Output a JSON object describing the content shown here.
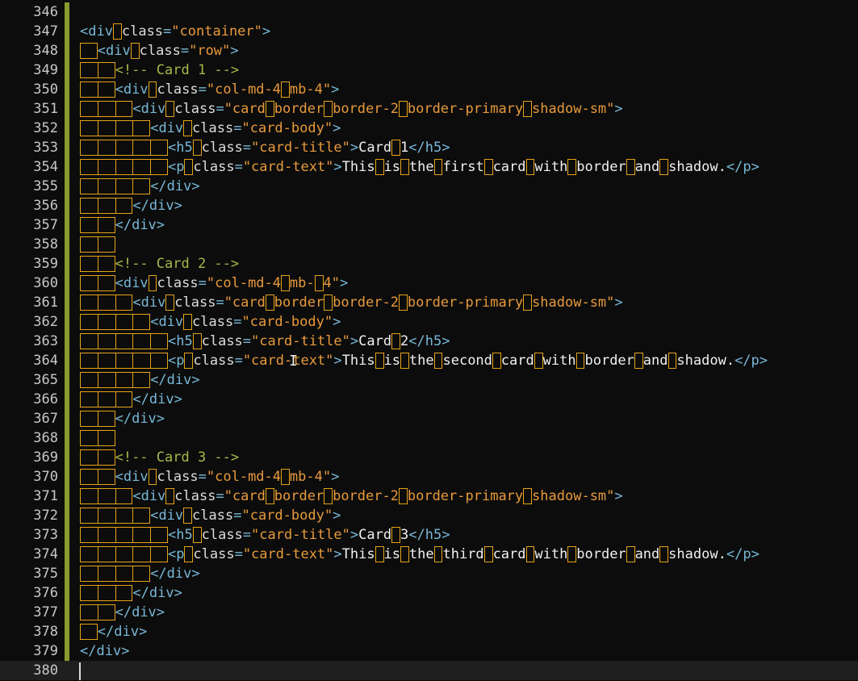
{
  "editor": {
    "colors": {
      "background": "#0c0c0c",
      "current_line": "#1f1f1f",
      "line_number": "#c8c8c8",
      "tag": "#78b8d8",
      "attr": "#dcdcdc",
      "string": "#e89a3c",
      "comment": "#a6b84a",
      "text": "#f0f0f0",
      "whitespace_marker": "#e6a317",
      "modified_bar": "#8a9a2f"
    },
    "current_line": 380,
    "lines": [
      {
        "n": "346",
        "ind": 0,
        "tokens": []
      },
      {
        "n": "347",
        "ind": 0,
        "tokens": [
          [
            "p",
            "<"
          ],
          [
            "t",
            "div"
          ],
          [
            "s",
            " "
          ],
          [
            "a",
            "class"
          ],
          [
            "p",
            "="
          ],
          [
            "v",
            "\"container\""
          ],
          [
            "p",
            ">"
          ]
        ]
      },
      {
        "n": "348",
        "ind": 1,
        "tokens": [
          [
            "p",
            "<"
          ],
          [
            "t",
            "div"
          ],
          [
            "s",
            " "
          ],
          [
            "a",
            "class"
          ],
          [
            "p",
            "="
          ],
          [
            "v",
            "\"row\""
          ],
          [
            "p",
            ">"
          ]
        ]
      },
      {
        "n": "349",
        "ind": 2,
        "tokens": [
          [
            "c",
            "<!-- Card 1 -->"
          ]
        ]
      },
      {
        "n": "350",
        "ind": 2,
        "tokens": [
          [
            "p",
            "<"
          ],
          [
            "t",
            "div"
          ],
          [
            "s",
            " "
          ],
          [
            "a",
            "class"
          ],
          [
            "p",
            "="
          ],
          [
            "v",
            "\"col-md-4"
          ],
          [
            "s",
            " "
          ],
          [
            "v",
            "mb-4\""
          ],
          [
            "p",
            ">"
          ]
        ]
      },
      {
        "n": "351",
        "ind": 3,
        "tokens": [
          [
            "p",
            "<"
          ],
          [
            "t",
            "div"
          ],
          [
            "s",
            " "
          ],
          [
            "a",
            "class"
          ],
          [
            "p",
            "="
          ],
          [
            "v",
            "\"card"
          ],
          [
            "s",
            " "
          ],
          [
            "v",
            "border"
          ],
          [
            "s",
            " "
          ],
          [
            "v",
            "border-2"
          ],
          [
            "s",
            " "
          ],
          [
            "v",
            "border-primary"
          ],
          [
            "s",
            " "
          ],
          [
            "v",
            "shadow-sm\""
          ],
          [
            "p",
            ">"
          ]
        ]
      },
      {
        "n": "352",
        "ind": 4,
        "tokens": [
          [
            "p",
            "<"
          ],
          [
            "t",
            "div"
          ],
          [
            "s",
            " "
          ],
          [
            "a",
            "class"
          ],
          [
            "p",
            "="
          ],
          [
            "v",
            "\"card-body\""
          ],
          [
            "p",
            ">"
          ]
        ]
      },
      {
        "n": "353",
        "ind": 5,
        "tokens": [
          [
            "p",
            "<"
          ],
          [
            "t",
            "h5"
          ],
          [
            "s",
            " "
          ],
          [
            "a",
            "class"
          ],
          [
            "p",
            "="
          ],
          [
            "v",
            "\"card-title\""
          ],
          [
            "p",
            ">"
          ],
          [
            "x",
            "Card"
          ],
          [
            "s",
            " "
          ],
          [
            "x",
            "1"
          ],
          [
            "p",
            "</"
          ],
          [
            "t",
            "h5"
          ],
          [
            "p",
            ">"
          ]
        ]
      },
      {
        "n": "354",
        "ind": 5,
        "tokens": [
          [
            "p",
            "<"
          ],
          [
            "t",
            "p"
          ],
          [
            "s",
            " "
          ],
          [
            "a",
            "class"
          ],
          [
            "p",
            "="
          ],
          [
            "v",
            "\"card-text\""
          ],
          [
            "p",
            ">"
          ],
          [
            "x",
            "This"
          ],
          [
            "s",
            " "
          ],
          [
            "x",
            "is"
          ],
          [
            "s",
            " "
          ],
          [
            "x",
            "the"
          ],
          [
            "s",
            " "
          ],
          [
            "x",
            "first"
          ],
          [
            "s",
            " "
          ],
          [
            "x",
            "card"
          ],
          [
            "s",
            " "
          ],
          [
            "x",
            "with"
          ],
          [
            "s",
            " "
          ],
          [
            "x",
            "border"
          ],
          [
            "s",
            " "
          ],
          [
            "x",
            "and"
          ],
          [
            "s",
            " "
          ],
          [
            "x",
            "shadow."
          ],
          [
            "p",
            "</"
          ],
          [
            "t",
            "p"
          ],
          [
            "p",
            ">"
          ]
        ]
      },
      {
        "n": "355",
        "ind": 4,
        "tokens": [
          [
            "p",
            "</"
          ],
          [
            "t",
            "div"
          ],
          [
            "p",
            ">"
          ]
        ]
      },
      {
        "n": "356",
        "ind": 3,
        "tokens": [
          [
            "p",
            "</"
          ],
          [
            "t",
            "div"
          ],
          [
            "p",
            ">"
          ]
        ]
      },
      {
        "n": "357",
        "ind": 2,
        "tokens": [
          [
            "p",
            "</"
          ],
          [
            "t",
            "div"
          ],
          [
            "p",
            ">"
          ]
        ]
      },
      {
        "n": "358",
        "ind": 2,
        "tokens": []
      },
      {
        "n": "359",
        "ind": 2,
        "tokens": [
          [
            "c",
            "<!-- Card 2 -->"
          ]
        ]
      },
      {
        "n": "360",
        "ind": 2,
        "tokens": [
          [
            "p",
            "<"
          ],
          [
            "t",
            "div"
          ],
          [
            "s",
            " "
          ],
          [
            "a",
            "class"
          ],
          [
            "p",
            "="
          ],
          [
            "v",
            "\"col-md-4"
          ],
          [
            "s",
            " "
          ],
          [
            "v",
            "mb-"
          ],
          [
            "s",
            " "
          ],
          [
            "v",
            "4\""
          ],
          [
            "p",
            ">"
          ]
        ]
      },
      {
        "n": "361",
        "ind": 3,
        "tokens": [
          [
            "p",
            "<"
          ],
          [
            "t",
            "div"
          ],
          [
            "s",
            " "
          ],
          [
            "a",
            "class"
          ],
          [
            "p",
            "="
          ],
          [
            "v",
            "\"card"
          ],
          [
            "s",
            " "
          ],
          [
            "v",
            "border"
          ],
          [
            "s",
            " "
          ],
          [
            "v",
            "border-2"
          ],
          [
            "s",
            " "
          ],
          [
            "v",
            "border-primary"
          ],
          [
            "s",
            " "
          ],
          [
            "v",
            "shadow-sm\""
          ],
          [
            "p",
            ">"
          ]
        ]
      },
      {
        "n": "362",
        "ind": 4,
        "tokens": [
          [
            "p",
            "<"
          ],
          [
            "t",
            "div"
          ],
          [
            "s",
            " "
          ],
          [
            "a",
            "class"
          ],
          [
            "p",
            "="
          ],
          [
            "v",
            "\"card-body\""
          ],
          [
            "p",
            ">"
          ]
        ]
      },
      {
        "n": "363",
        "ind": 5,
        "tokens": [
          [
            "p",
            "<"
          ],
          [
            "t",
            "h5"
          ],
          [
            "s",
            " "
          ],
          [
            "a",
            "class"
          ],
          [
            "p",
            "="
          ],
          [
            "v",
            "\"card-title\""
          ],
          [
            "p",
            ">"
          ],
          [
            "x",
            "Card"
          ],
          [
            "s",
            " "
          ],
          [
            "x",
            "2"
          ],
          [
            "p",
            "</"
          ],
          [
            "t",
            "h5"
          ],
          [
            "p",
            ">"
          ]
        ]
      },
      {
        "n": "364",
        "ind": 5,
        "tokens": [
          [
            "p",
            "<"
          ],
          [
            "t",
            "p"
          ],
          [
            "s",
            " "
          ],
          [
            "a",
            "class"
          ],
          [
            "p",
            "="
          ],
          [
            "v",
            "\"card-text\""
          ],
          [
            "p",
            ">"
          ],
          [
            "x",
            "This"
          ],
          [
            "s",
            " "
          ],
          [
            "x",
            "is"
          ],
          [
            "s",
            " "
          ],
          [
            "x",
            "the"
          ],
          [
            "s",
            " "
          ],
          [
            "x",
            "second"
          ],
          [
            "s",
            " "
          ],
          [
            "x",
            "card"
          ],
          [
            "s",
            " "
          ],
          [
            "x",
            "with"
          ],
          [
            "s",
            " "
          ],
          [
            "x",
            "border"
          ],
          [
            "s",
            " "
          ],
          [
            "x",
            "and"
          ],
          [
            "s",
            " "
          ],
          [
            "x",
            "shadow."
          ],
          [
            "p",
            "</"
          ],
          [
            "t",
            "p"
          ],
          [
            "p",
            ">"
          ]
        ]
      },
      {
        "n": "365",
        "ind": 4,
        "tokens": [
          [
            "p",
            "</"
          ],
          [
            "t",
            "div"
          ],
          [
            "p",
            ">"
          ]
        ]
      },
      {
        "n": "366",
        "ind": 3,
        "tokens": [
          [
            "p",
            "</"
          ],
          [
            "t",
            "div"
          ],
          [
            "p",
            ">"
          ]
        ]
      },
      {
        "n": "367",
        "ind": 2,
        "tokens": [
          [
            "p",
            "</"
          ],
          [
            "t",
            "div"
          ],
          [
            "p",
            ">"
          ]
        ]
      },
      {
        "n": "368",
        "ind": 2,
        "tokens": []
      },
      {
        "n": "369",
        "ind": 2,
        "tokens": [
          [
            "c",
            "<!-- Card 3 -->"
          ]
        ]
      },
      {
        "n": "370",
        "ind": 2,
        "tokens": [
          [
            "p",
            "<"
          ],
          [
            "t",
            "div"
          ],
          [
            "s",
            " "
          ],
          [
            "a",
            "class"
          ],
          [
            "p",
            "="
          ],
          [
            "v",
            "\"col-md-4"
          ],
          [
            "s",
            " "
          ],
          [
            "v",
            "mb-4\""
          ],
          [
            "p",
            ">"
          ]
        ]
      },
      {
        "n": "371",
        "ind": 3,
        "tokens": [
          [
            "p",
            "<"
          ],
          [
            "t",
            "div"
          ],
          [
            "s",
            " "
          ],
          [
            "a",
            "class"
          ],
          [
            "p",
            "="
          ],
          [
            "v",
            "\"card"
          ],
          [
            "s",
            " "
          ],
          [
            "v",
            "border"
          ],
          [
            "s",
            " "
          ],
          [
            "v",
            "border-2"
          ],
          [
            "s",
            " "
          ],
          [
            "v",
            "border-primary"
          ],
          [
            "s",
            " "
          ],
          [
            "v",
            "shadow-sm\""
          ],
          [
            "p",
            ">"
          ]
        ]
      },
      {
        "n": "372",
        "ind": 4,
        "tokens": [
          [
            "p",
            "<"
          ],
          [
            "t",
            "div"
          ],
          [
            "s",
            " "
          ],
          [
            "a",
            "class"
          ],
          [
            "p",
            "="
          ],
          [
            "v",
            "\"card-body\""
          ],
          [
            "p",
            ">"
          ]
        ]
      },
      {
        "n": "373",
        "ind": 5,
        "tokens": [
          [
            "p",
            "<"
          ],
          [
            "t",
            "h5"
          ],
          [
            "s",
            " "
          ],
          [
            "a",
            "class"
          ],
          [
            "p",
            "="
          ],
          [
            "v",
            "\"card-title\""
          ],
          [
            "p",
            ">"
          ],
          [
            "x",
            "Card"
          ],
          [
            "s",
            " "
          ],
          [
            "x",
            "3"
          ],
          [
            "p",
            "</"
          ],
          [
            "t",
            "h5"
          ],
          [
            "p",
            ">"
          ]
        ]
      },
      {
        "n": "374",
        "ind": 5,
        "tokens": [
          [
            "p",
            "<"
          ],
          [
            "t",
            "p"
          ],
          [
            "s",
            " "
          ],
          [
            "a",
            "class"
          ],
          [
            "p",
            "="
          ],
          [
            "v",
            "\"card-text\""
          ],
          [
            "p",
            ">"
          ],
          [
            "x",
            "This"
          ],
          [
            "s",
            " "
          ],
          [
            "x",
            "is"
          ],
          [
            "s",
            " "
          ],
          [
            "x",
            "the"
          ],
          [
            "s",
            " "
          ],
          [
            "x",
            "third"
          ],
          [
            "s",
            " "
          ],
          [
            "x",
            "card"
          ],
          [
            "s",
            " "
          ],
          [
            "x",
            "with"
          ],
          [
            "s",
            " "
          ],
          [
            "x",
            "border"
          ],
          [
            "s",
            " "
          ],
          [
            "x",
            "and"
          ],
          [
            "s",
            " "
          ],
          [
            "x",
            "shadow."
          ],
          [
            "p",
            "</"
          ],
          [
            "t",
            "p"
          ],
          [
            "p",
            ">"
          ]
        ]
      },
      {
        "n": "375",
        "ind": 4,
        "tokens": [
          [
            "p",
            "</"
          ],
          [
            "t",
            "div"
          ],
          [
            "p",
            ">"
          ]
        ]
      },
      {
        "n": "376",
        "ind": 3,
        "tokens": [
          [
            "p",
            "</"
          ],
          [
            "t",
            "div"
          ],
          [
            "p",
            ">"
          ]
        ]
      },
      {
        "n": "377",
        "ind": 2,
        "tokens": [
          [
            "p",
            "</"
          ],
          [
            "t",
            "div"
          ],
          [
            "p",
            ">"
          ]
        ]
      },
      {
        "n": "378",
        "ind": 1,
        "tokens": [
          [
            "p",
            "</"
          ],
          [
            "t",
            "div"
          ],
          [
            "p",
            ">"
          ]
        ]
      },
      {
        "n": "379",
        "ind": 0,
        "tokens": [
          [
            "p",
            "</"
          ],
          [
            "t",
            "div"
          ],
          [
            "p",
            ">"
          ]
        ]
      },
      {
        "n": "380",
        "ind": 0,
        "tokens": []
      }
    ]
  }
}
